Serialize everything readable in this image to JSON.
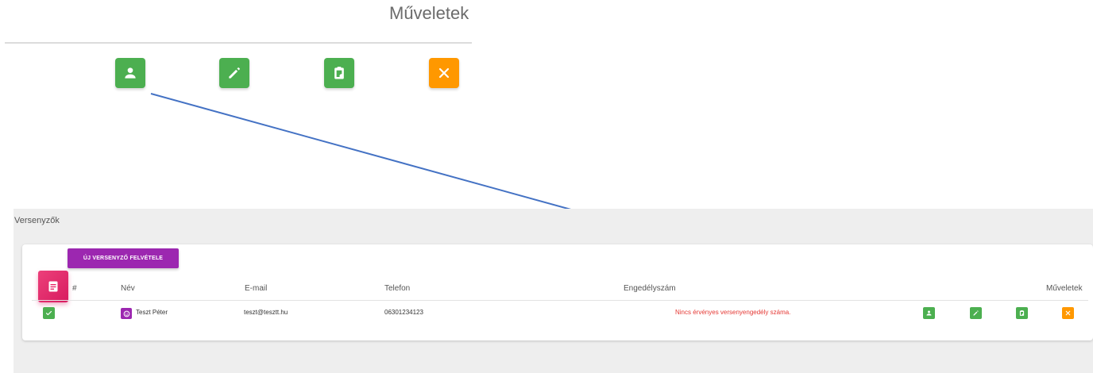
{
  "zoom": {
    "header_label": "Műveletek",
    "buttons": [
      {
        "icon": "person-icon",
        "color": "#4caf50"
      },
      {
        "icon": "pencil-icon",
        "color": "#4caf50"
      },
      {
        "icon": "clipboard-icon",
        "color": "#4caf50"
      },
      {
        "icon": "close-icon",
        "color": "#ff9800"
      }
    ]
  },
  "arrow": {
    "color": "#4472c4"
  },
  "page": {
    "title": "Versenyzők"
  },
  "card": {
    "icon": "note-icon",
    "new_button_label": "ÚJ VERSENYZŐ FELVÉTELE"
  },
  "table": {
    "headers": {
      "index": "#",
      "name": "Név",
      "email": "E-mail",
      "phone": "Telefon",
      "license": "Engedélyszám",
      "actions": "Műveletek"
    },
    "rows": [
      {
        "status_icon": "check-icon",
        "avatar_icon": "smiley-icon",
        "name": "Teszt Péter",
        "email": "teszt@tesztt.hu",
        "phone": "06301234123",
        "license": "Nincs érvényes versenyengedély száma."
      }
    ]
  },
  "colors": {
    "green": "#4caf50",
    "orange": "#ff9800",
    "purple": "#9c27b0",
    "pink": "#e91e63",
    "error_red": "#e53935"
  }
}
